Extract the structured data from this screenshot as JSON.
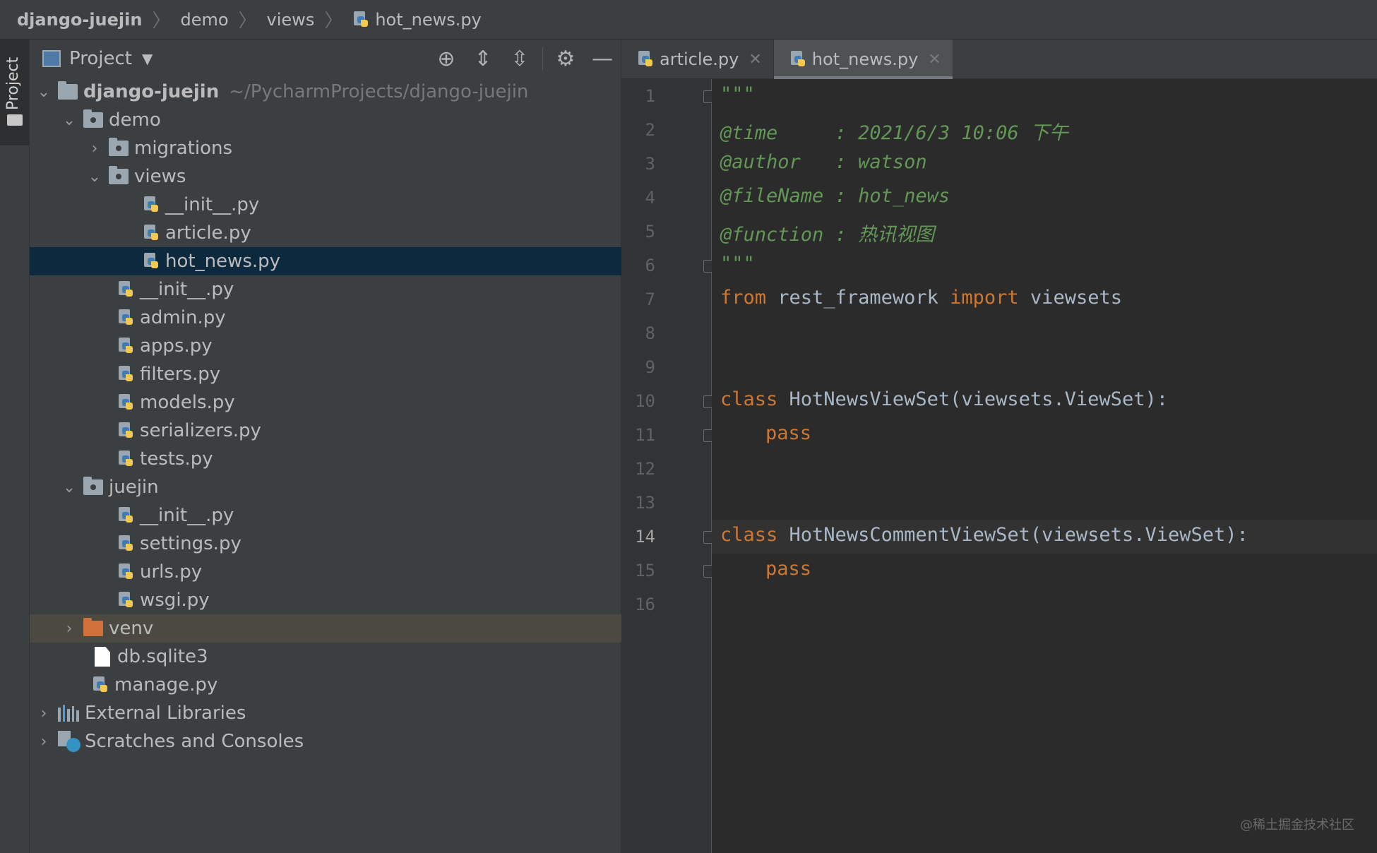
{
  "breadcrumb": {
    "root": "django-juejin",
    "items": [
      "demo",
      "views"
    ],
    "file": "hot_news.py"
  },
  "side_stripe": {
    "label": "Project"
  },
  "project_panel": {
    "title": "Project",
    "tools": [
      "locate-icon",
      "expand-all-icon",
      "collapse-all-icon",
      "gear-icon",
      "minimize-icon"
    ]
  },
  "tree": {
    "root_name": "django-juejin",
    "root_path": "~/PycharmProjects/django-juejin",
    "demo": "demo",
    "migrations": "migrations",
    "views": "views",
    "views_init": "__init__.py",
    "views_article": "article.py",
    "views_hot_news": "hot_news.py",
    "demo_init": "__init__.py",
    "admin": "admin.py",
    "apps": "apps.py",
    "filters": "filters.py",
    "models": "models.py",
    "serializers": "serializers.py",
    "tests": "tests.py",
    "juejin": "juejin",
    "juejin_init": "__init__.py",
    "settings": "settings.py",
    "urls": "urls.py",
    "wsgi": "wsgi.py",
    "venv": "venv",
    "db": "db.sqlite3",
    "manage": "manage.py",
    "external": "External Libraries",
    "scratches": "Scratches and Consoles"
  },
  "tabs": [
    {
      "label": "article.py",
      "active": false
    },
    {
      "label": "hot_news.py",
      "active": true
    }
  ],
  "editor": {
    "current_line": 14,
    "line_numbers": [
      "1",
      "2",
      "3",
      "4",
      "5",
      "6",
      "7",
      "8",
      "9",
      "10",
      "11",
      "12",
      "13",
      "14",
      "15",
      "16"
    ],
    "lines": {
      "l1": "\"\"\"",
      "l2": "@time     : 2021/6/3 10:06 下午",
      "l3": "@author   : watson",
      "l4": "@fileName : hot_news",
      "l5": "@function : 热讯视图",
      "l6": "\"\"\"",
      "l7_from": "from",
      "l7_mod": " rest_framework ",
      "l7_import": "import",
      "l7_name": " viewsets",
      "l10_kw": "class",
      "l10_rest": " HotNewsViewSet(viewsets.ViewSet):",
      "l11": "pass",
      "l14_kw": "class",
      "l14_rest": " HotNewsCommentViewSet(viewsets.ViewSet):",
      "l15": "pass"
    }
  },
  "watermark": "@稀土掘金技术社区",
  "colors": {
    "background": "#2b2b2b",
    "panel": "#3c3f41",
    "selection": "#0d293e",
    "keyword": "#cc7832",
    "docstring": "#629755",
    "text": "#a9b7c6"
  }
}
